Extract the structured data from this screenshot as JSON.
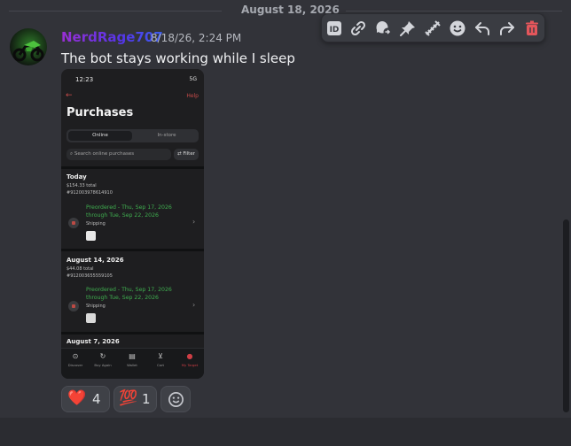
{
  "date_divider": "August 18, 2026",
  "message": {
    "username": "NerdRage707",
    "timestamp": "8/18/26, 2:24 PM",
    "text": "The bot stays working while I sleep"
  },
  "attachment": {
    "status_time": "12:23",
    "status_signal": "5G",
    "help": "Help",
    "title": "Purchases",
    "seg_online": "Online",
    "seg_instore": "In-store",
    "search_placeholder": "Search online purchases",
    "filter": "Filter",
    "orders": [
      {
        "section": "Today",
        "total": "$154.33 total",
        "order_no": "#912003978614910",
        "status_line1": "Preordered - Thu, Sep 17, 2026",
        "status_line2": "through Tue, Sep 22, 2026",
        "method": "Shipping"
      },
      {
        "section": "August 14, 2026",
        "total": "$44.08 total",
        "order_no": "#912003655559105",
        "status_line1": "Preordered - Thu, Sep 17, 2026",
        "status_line2": "through Tue, Sep 22, 2026",
        "method": "Shipping"
      }
    ],
    "next_section": "August 7, 2026",
    "nav": [
      "Discover",
      "Buy Again",
      "Wallet",
      "Cart",
      "My Target"
    ]
  },
  "reactions": [
    {
      "emoji": "❤️",
      "count": "4"
    },
    {
      "emoji": "💯",
      "count": "1"
    }
  ],
  "icons": {
    "toolbar": [
      "id-icon",
      "link-icon",
      "reply-thread-icon",
      "pin-icon",
      "forward-icon",
      "emoji-icon",
      "reply-icon",
      "share-icon",
      "delete-icon"
    ]
  },
  "colors": {
    "background": "#323339",
    "delete": "#e3565b",
    "username_gradient_start": "#9a2fd3",
    "username_gradient_end": "#3b5df0"
  }
}
